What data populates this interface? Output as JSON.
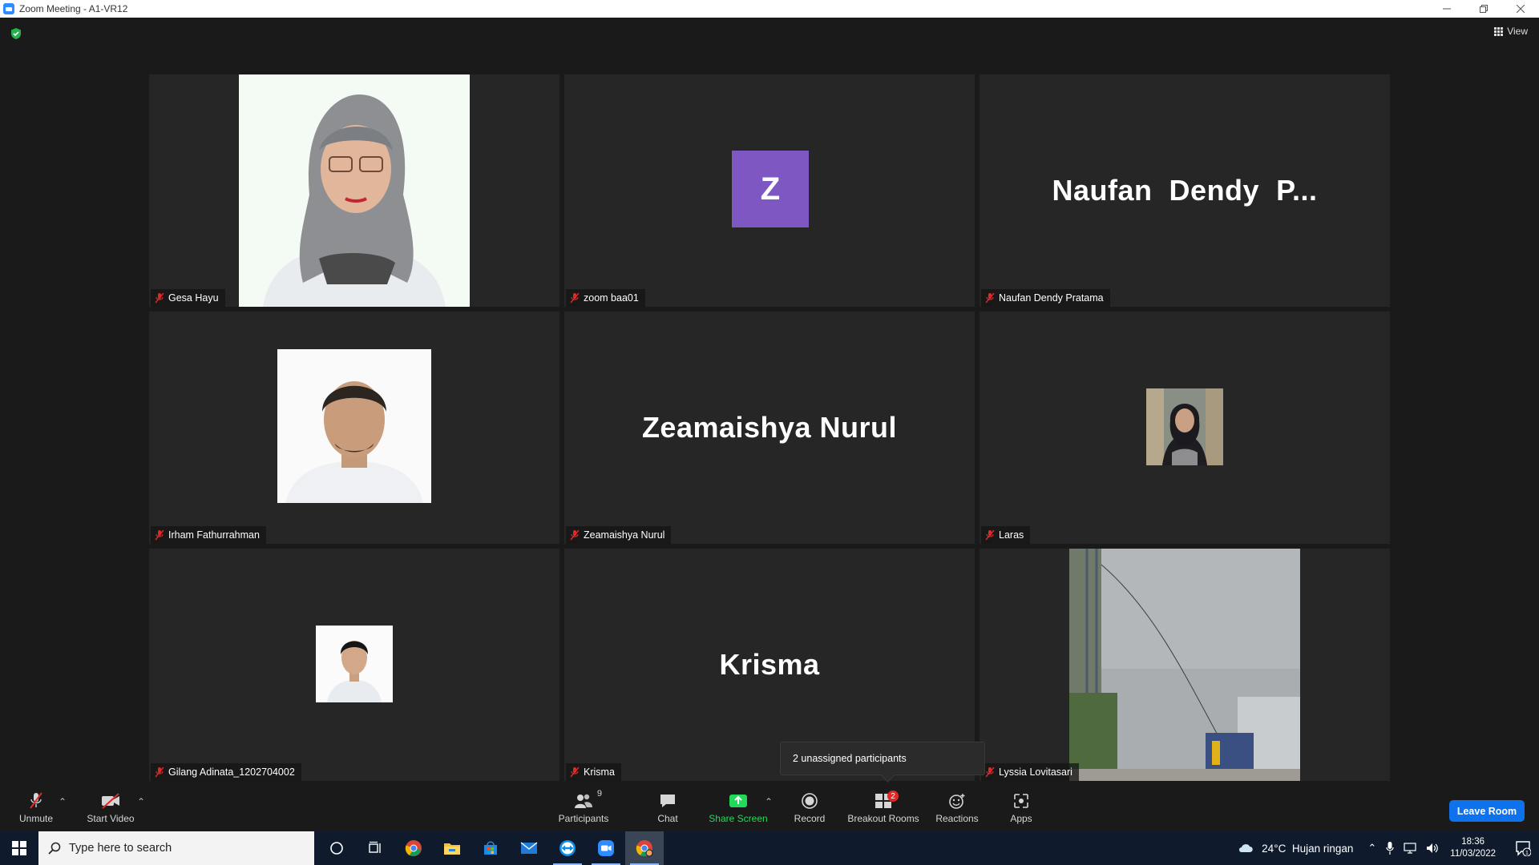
{
  "window": {
    "title": "Zoom Meeting - A1-VR12",
    "controls": [
      "minimize",
      "restore",
      "close"
    ]
  },
  "top_bar": {
    "view_label": "View"
  },
  "tiles": [
    {
      "name": "Gesa Hayu",
      "display": "photo",
      "muted": true
    },
    {
      "name": "zoom baa01",
      "display": "avatar",
      "avatar_letter": "Z",
      "avatar_color": "#7e57c2",
      "muted": true
    },
    {
      "name": "Naufan Dendy Pratama",
      "display": "text",
      "big_name": "Naufan  Dendy  P...",
      "muted": true
    },
    {
      "name": "Irham Fathurrahman",
      "display": "photo",
      "muted": true
    },
    {
      "name": "Zeamaishya Nurul",
      "display": "text",
      "big_name": "Zeamaishya Nurul",
      "muted": true
    },
    {
      "name": "Laras",
      "display": "photo",
      "muted": true
    },
    {
      "name": "Gilang Adinata_1202704002",
      "display": "photo",
      "muted": true
    },
    {
      "name": "Krisma",
      "display": "text",
      "big_name": "Krisma",
      "muted": true
    },
    {
      "name": "Lyssia Lovitasari",
      "display": "video",
      "muted": true
    }
  ],
  "popup": {
    "text": "2 unassigned participants"
  },
  "toolbar": {
    "unmute": "Unmute",
    "start_video": "Start Video",
    "participants": "Participants",
    "participants_count": "9",
    "chat": "Chat",
    "share_screen": "Share Screen",
    "record": "Record",
    "breakout_rooms": "Breakout Rooms",
    "breakout_badge": "2",
    "reactions": "Reactions",
    "apps": "Apps",
    "leave": "Leave Room",
    "share_color": "#23d959"
  },
  "taskbar": {
    "search_placeholder": "Type here to search",
    "weather": "24°C  Hujan ringan",
    "time": "18:36",
    "date": "11/03/2022",
    "notification_count": "1"
  }
}
